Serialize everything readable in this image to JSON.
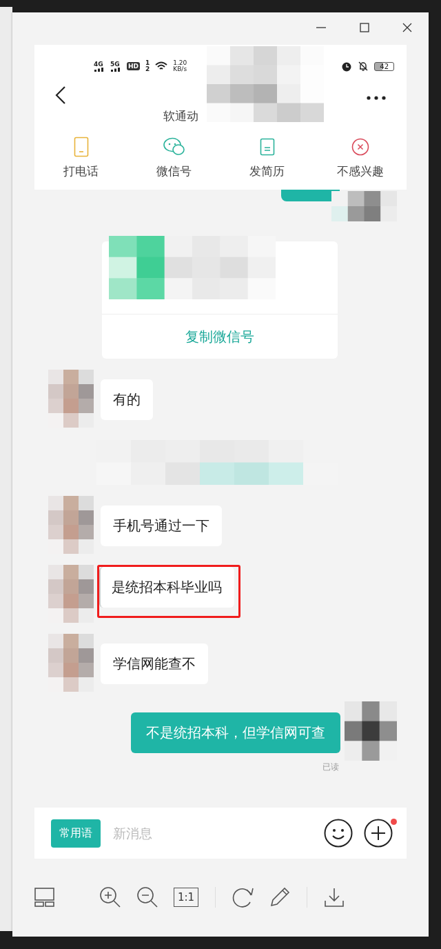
{
  "viewer": {
    "controls": [
      {
        "kind": "minimize"
      },
      {
        "kind": "maximize"
      },
      {
        "kind": "close"
      }
    ],
    "toolbar": [
      {
        "kind": "thumbnails"
      },
      {
        "kind": "zoom_in"
      },
      {
        "kind": "zoom_out"
      },
      {
        "kind": "actual_size",
        "label": "1:1"
      },
      {
        "kind": "divider"
      },
      {
        "kind": "rotate"
      },
      {
        "kind": "edit"
      },
      {
        "kind": "divider"
      },
      {
        "kind": "download"
      }
    ]
  },
  "phone": {
    "status_bar": {
      "signals": [
        "4G",
        "5G"
      ],
      "hd": "HD",
      "sims": [
        "1",
        "2"
      ],
      "speed": "1.20",
      "speed_unit": "KB/s",
      "battery": "42"
    },
    "header": {
      "title": "软通动"
    },
    "actions": [
      {
        "kind": "phone",
        "label": "打电话"
      },
      {
        "kind": "wechat",
        "label": "微信号"
      },
      {
        "kind": "resume",
        "label": "发简历"
      },
      {
        "kind": "reject",
        "label": "不感兴趣"
      }
    ],
    "messages": [
      {
        "kind": "sent_cut"
      },
      {
        "kind": "card",
        "button": "复制微信号"
      },
      {
        "kind": "received",
        "text": "有的",
        "highlighted": false
      },
      {
        "kind": "notice"
      },
      {
        "kind": "received",
        "text": "手机号通过一下",
        "highlighted": false
      },
      {
        "kind": "received",
        "text": "是统招本科毕业吗",
        "highlighted": true
      },
      {
        "kind": "received",
        "text": "学信网能查不",
        "highlighted": false
      },
      {
        "kind": "sent",
        "text": "不是统招本科，但学信网可查",
        "status": "已读"
      }
    ],
    "input_bar": {
      "phrases_button": "常用语",
      "placeholder": "新消息",
      "has_notification": true
    }
  }
}
